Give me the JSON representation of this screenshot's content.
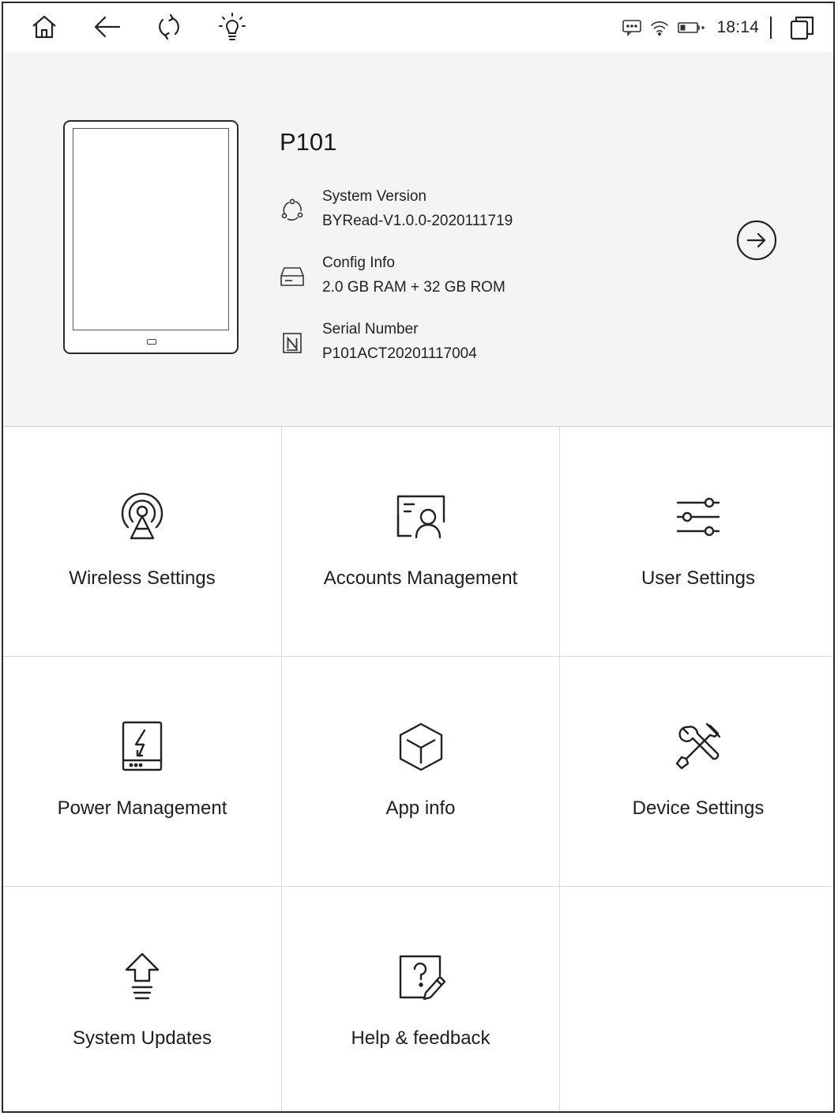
{
  "status_bar": {
    "left_icons": [
      "home-icon",
      "back-arrow-icon",
      "refresh-icon",
      "frontlight-bulb-icon"
    ],
    "right_icons": [
      "message-icon",
      "wifi-icon",
      "battery-charging-icon"
    ],
    "time": "18:14",
    "task_switch_icon": "recent-apps-icon"
  },
  "device": {
    "model": "P101",
    "info": [
      {
        "icon": "system-version-icon",
        "label": "System Version",
        "value": "BYRead-V1.0.0-2020111719"
      },
      {
        "icon": "config-storage-icon",
        "label": "Config Info",
        "value": "2.0 GB RAM + 32 GB ROM"
      },
      {
        "icon": "serial-number-icon",
        "label": "Serial Number",
        "value": "P101ACT20201117004"
      }
    ],
    "details_icon": "arrow-right-circle-icon"
  },
  "settings": [
    {
      "label": "Wireless Settings",
      "icon": "wireless-antenna-icon"
    },
    {
      "label": "Accounts Management",
      "icon": "account-card-icon"
    },
    {
      "label": "User Settings",
      "icon": "sliders-icon"
    },
    {
      "label": "Power Management",
      "icon": "power-battery-icon"
    },
    {
      "label": "App info",
      "icon": "app-cube-icon"
    },
    {
      "label": "Device Settings",
      "icon": "tools-icon"
    },
    {
      "label": "System Updates",
      "icon": "update-arrow-icon"
    },
    {
      "label": "Help & feedback",
      "icon": "help-feedback-icon"
    }
  ]
}
